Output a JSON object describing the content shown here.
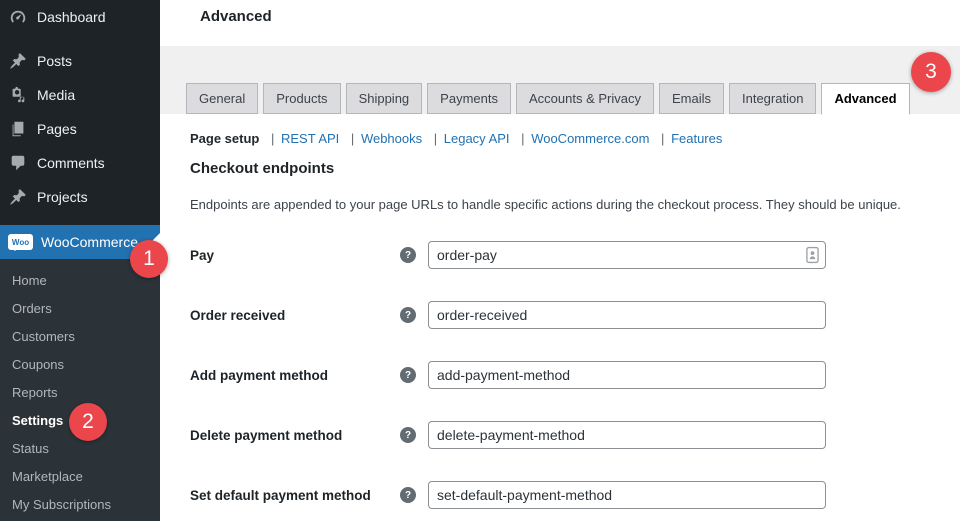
{
  "colors": {
    "accent_blue": "#2271b1",
    "badge_red": "#eb464b",
    "sidebar_bg": "#1d2327",
    "submenu_bg": "#2c3338",
    "band_bg": "#f0f0f1",
    "content_bg": "#ffffff"
  },
  "sidebar": {
    "menu": [
      {
        "label": "Dashboard",
        "icon": "dashboard-icon"
      },
      {
        "label": "Posts",
        "icon": "pushpin-icon"
      },
      {
        "label": "Media",
        "icon": "media-icon"
      },
      {
        "label": "Pages",
        "icon": "pages-icon"
      },
      {
        "label": "Comments",
        "icon": "comments-icon"
      },
      {
        "label": "Projects",
        "icon": "pushpin-icon"
      }
    ],
    "woocommerce": {
      "label": "WooCommerce",
      "logo_text": "Woo"
    },
    "submenu": [
      "Home",
      "Orders",
      "Customers",
      "Coupons",
      "Reports",
      "Settings",
      "Status",
      "Marketplace",
      "My Subscriptions"
    ],
    "active_submenu": "Settings"
  },
  "header": {
    "title": "Advanced"
  },
  "tabs": {
    "items": [
      "General",
      "Products",
      "Shipping",
      "Payments",
      "Accounts & Privacy",
      "Emails",
      "Integration",
      "Advanced"
    ],
    "active": "Advanced"
  },
  "subnav": {
    "current": "Page setup",
    "separator": "|",
    "links": [
      "REST API",
      "Webhooks",
      "Legacy API",
      "WooCommerce.com",
      "Features"
    ]
  },
  "section": {
    "heading": "Checkout endpoints",
    "description": "Endpoints are appended to your page URLs to handle specific actions during the checkout process. They should be unique."
  },
  "fields": [
    {
      "label": "Pay",
      "value": "order-pay"
    },
    {
      "label": "Order received",
      "value": "order-received"
    },
    {
      "label": "Add payment method",
      "value": "add-payment-method"
    },
    {
      "label": "Delete payment method",
      "value": "delete-payment-method"
    },
    {
      "label": "Set default payment method",
      "value": "set-default-payment-method"
    }
  ],
  "icons": {
    "help": "?"
  },
  "annotations": {
    "badges": [
      "1",
      "2",
      "3"
    ]
  }
}
